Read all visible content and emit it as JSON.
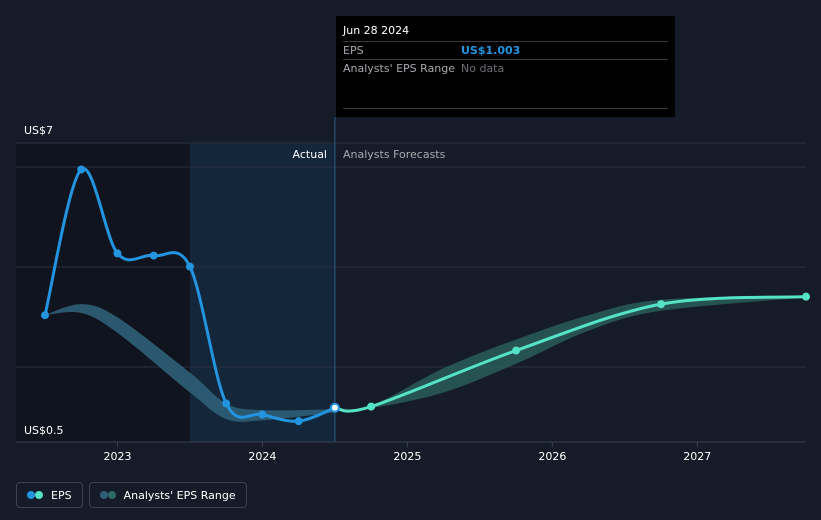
{
  "tooltip": {
    "date": "Jun 28 2024",
    "rows": [
      {
        "label": "EPS",
        "value": "US$1.003"
      },
      {
        "label": "Analysts' EPS Range",
        "value": "No data"
      }
    ]
  },
  "regions": {
    "actual_label": "Actual",
    "forecast_label": "Analysts Forecasts"
  },
  "legend": {
    "eps_label": "EPS",
    "range_label": "Analysts' EPS Range"
  },
  "colors": {
    "actual_line": "#2394df",
    "forecast_line": "#55e3c8",
    "range_band": "#2f5f78",
    "forecast_band": "#2d6b64",
    "background": "#151b28"
  },
  "chart_data": {
    "type": "line",
    "y_axis": {
      "top_label": "US$7",
      "bottom_label": "US$0.5",
      "range": [
        0.5,
        7
      ]
    },
    "x_ticks": [
      {
        "label": "2023",
        "t": 2023.0
      },
      {
        "label": "2024",
        "t": 2024.0
      },
      {
        "label": "2025",
        "t": 2025.0
      },
      {
        "label": "2026",
        "t": 2026.0
      },
      {
        "label": "2027",
        "t": 2027.0
      }
    ],
    "x_range": [
      2022.3,
      2027.75
    ],
    "actual_start": 2023.5,
    "actual_end": 2024.5,
    "series": [
      {
        "name": "EPS",
        "role": "actual",
        "points": [
          [
            2022.5,
            3.1
          ],
          [
            2022.75,
            6.4
          ],
          [
            2023.0,
            4.5
          ],
          [
            2023.25,
            4.45
          ],
          [
            2023.5,
            4.2
          ],
          [
            2023.75,
            1.1
          ],
          [
            2024.0,
            0.85
          ],
          [
            2024.25,
            0.7
          ],
          [
            2024.5,
            1.003
          ]
        ]
      },
      {
        "name": "EPS forecast",
        "role": "forecast",
        "points": [
          [
            2024.5,
            1.003
          ],
          [
            2024.75,
            1.03
          ],
          [
            2025.75,
            2.3
          ],
          [
            2026.75,
            3.35
          ],
          [
            2027.75,
            3.52
          ]
        ]
      }
    ],
    "range_band": {
      "upper": [
        [
          2022.5,
          3.1
        ],
        [
          2022.75,
          3.35
        ],
        [
          2023.0,
          3.05
        ],
        [
          2023.5,
          1.8
        ],
        [
          2023.75,
          1.1
        ],
        [
          2024.0,
          0.95
        ],
        [
          2024.5,
          0.97
        ]
      ],
      "lower": [
        [
          2022.5,
          3.1
        ],
        [
          2022.75,
          3.15
        ],
        [
          2023.0,
          2.7
        ],
        [
          2023.5,
          1.35
        ],
        [
          2023.75,
          0.75
        ],
        [
          2024.0,
          0.72
        ],
        [
          2024.5,
          0.9
        ]
      ]
    },
    "forecast_band": {
      "upper": [
        [
          2024.5,
          1.003
        ],
        [
          2024.75,
          1.05
        ],
        [
          2025.25,
          1.9
        ],
        [
          2025.75,
          2.55
        ],
        [
          2026.25,
          3.1
        ],
        [
          2026.75,
          3.45
        ],
        [
          2027.75,
          3.55
        ]
      ],
      "lower": [
        [
          2024.5,
          1.003
        ],
        [
          2024.75,
          1.0
        ],
        [
          2025.25,
          1.35
        ],
        [
          2025.75,
          2.0
        ],
        [
          2026.25,
          2.75
        ],
        [
          2026.75,
          3.2
        ],
        [
          2027.75,
          3.5
        ]
      ]
    }
  }
}
